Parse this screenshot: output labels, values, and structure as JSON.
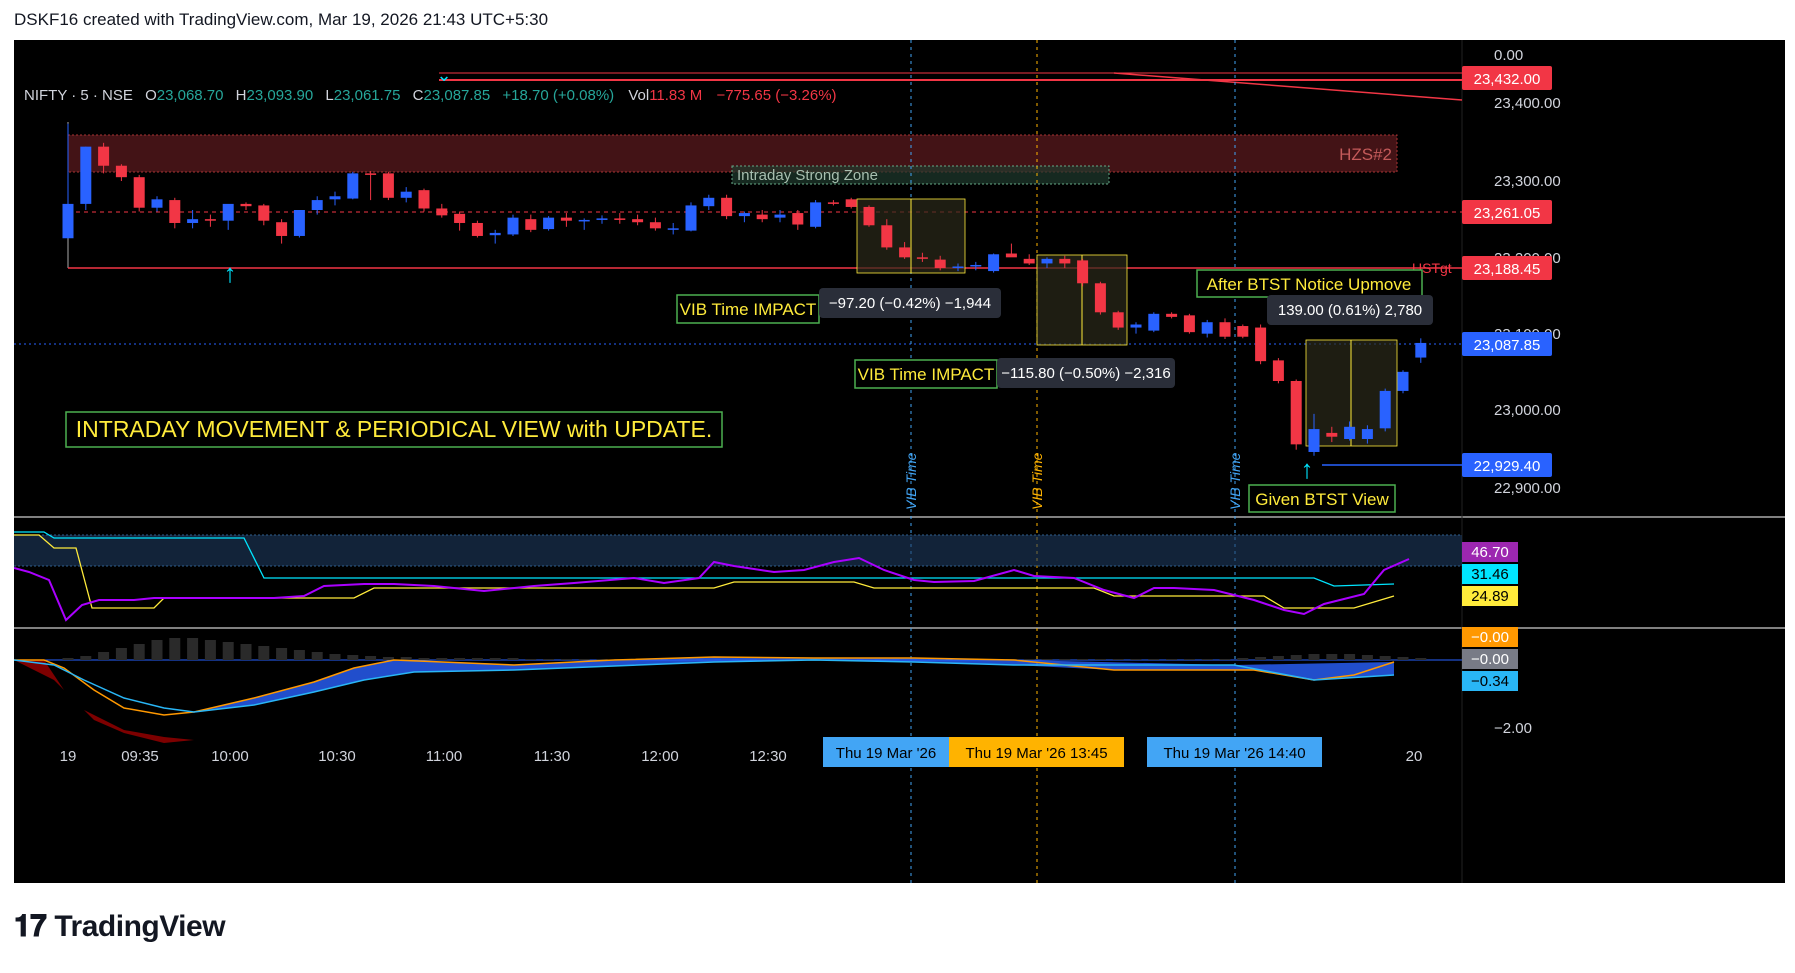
{
  "header": {
    "text": "DSKF16 created with TradingView.com, Mar 19, 2026 21:43 UTC+5:30"
  },
  "footer": {
    "logo_text": "TradingView",
    "logo_icon": "tradingview-logo-icon"
  },
  "legend": {
    "symbol": "NIFTY · 5 · NSE",
    "o_label": "O",
    "o": "23,068.70",
    "h_label": "H",
    "h": "23,093.90",
    "l_label": "L",
    "l": "23,061.75",
    "c_label": "C",
    "c": "23,087.85",
    "change": "+18.70 (+0.08%)",
    "vol_label": "Vol",
    "vol": "11.83 M",
    "vol_change": "−775.65 (−3.26%)"
  },
  "annotations": {
    "zone_label": "HZS#2",
    "strong_zone": "Intraday Strong Zone",
    "ustgt": "USTgt",
    "vib_impact_1": "VIB Time IMPACT",
    "vib_measure_1": "−97.20 (−0.42%) −1,944",
    "vib_impact_2": "VIB Time IMPACT",
    "vib_measure_2": "−115.80 (−0.50%) −2,316",
    "after_btst": "After BTST Notice Upmove",
    "btst_measure": "139.00 (0.61%) 2,780",
    "given_btst": "Given BTST View",
    "main_title": "INTRADAY MOVEMENT & PERIODICAL VIEW with UPDATE.",
    "vib_time": "VIB Time"
  },
  "price_badges": [
    {
      "text": "23,432.00",
      "color": "#f23645"
    },
    {
      "text": "23,261.05",
      "color": "#f23645"
    },
    {
      "text": "23,188.45",
      "color": "#f23645"
    },
    {
      "text": "23,087.85",
      "color": "#2962ff"
    },
    {
      "text": "22,929.40",
      "color": "#2962ff"
    }
  ],
  "price_ticks": [
    "0.00",
    "23,400.00",
    "23,300.00",
    "23,200.00",
    "23,100.00",
    "23,000.00",
    "22,900.00"
  ],
  "rsi_badges": [
    {
      "text": "46.70",
      "color": "#9c27b0"
    },
    {
      "text": "31.46",
      "color": "#00e5ff"
    },
    {
      "text": "24.89",
      "color": "#ffeb3b"
    }
  ],
  "macd_badges": [
    {
      "text": "−0.00",
      "color": "#ff9800"
    },
    {
      "text": "−0.00",
      "color": "#787b86"
    },
    {
      "text": "−0.34",
      "color": "#29b6f6"
    }
  ],
  "macd_ticks": [
    "−2.00"
  ],
  "time_ticks": [
    "19",
    "09:35",
    "10:00",
    "10:30",
    "11:00",
    "11:30",
    "12:00",
    "12:30",
    "20"
  ],
  "time_badges": [
    {
      "text": "Thu 19 Mar '26",
      "color": "#42a5f5"
    },
    {
      "text": "Thu 19 Mar '26   13:45",
      "color": "#ffb300"
    },
    {
      "text": "Thu 19 Mar '26   14:40",
      "color": "#42a5f5"
    }
  ],
  "colors": {
    "up": "#2962ff",
    "down": "#f23645",
    "background": "#000000",
    "accent_green": "#4caf50",
    "accent_yellow": "#ffeb3b"
  },
  "chart_data": {
    "type": "candlestick",
    "symbol": "NIFTY",
    "interval": "5",
    "exchange": "NSE",
    "ylim": [
      22870,
      23450
    ],
    "candles": [
      {
        "o": 23225,
        "h": 23375,
        "l": 23225,
        "c": 23270
      },
      {
        "o": 23270,
        "h": 23345,
        "l": 23262,
        "c": 23345
      },
      {
        "o": 23345,
        "h": 23350,
        "l": 23310,
        "c": 23320
      },
      {
        "o": 23320,
        "h": 23322,
        "l": 23300,
        "c": 23305
      },
      {
        "o": 23305,
        "h": 23308,
        "l": 23260,
        "c": 23265
      },
      {
        "o": 23265,
        "h": 23280,
        "l": 23260,
        "c": 23276
      },
      {
        "o": 23275,
        "h": 23278,
        "l": 23238,
        "c": 23245
      },
      {
        "o": 23245,
        "h": 23262,
        "l": 23238,
        "c": 23250
      },
      {
        "o": 23250,
        "h": 23256,
        "l": 23240,
        "c": 23248
      },
      {
        "o": 23248,
        "h": 23268,
        "l": 23236,
        "c": 23270
      },
      {
        "o": 23270,
        "h": 23272,
        "l": 23262,
        "c": 23267
      },
      {
        "o": 23268,
        "h": 23270,
        "l": 23242,
        "c": 23248
      },
      {
        "o": 23246,
        "h": 23250,
        "l": 23218,
        "c": 23228
      },
      {
        "o": 23228,
        "h": 23262,
        "l": 23226,
        "c": 23262
      },
      {
        "o": 23262,
        "h": 23280,
        "l": 23256,
        "c": 23275
      },
      {
        "o": 23276,
        "h": 23286,
        "l": 23268,
        "c": 23280
      },
      {
        "o": 23277,
        "h": 23312,
        "l": 23276,
        "c": 23310
      },
      {
        "o": 23310,
        "h": 23313,
        "l": 23275,
        "c": 23308
      },
      {
        "o": 23310,
        "h": 23312,
        "l": 23275,
        "c": 23278
      },
      {
        "o": 23278,
        "h": 23292,
        "l": 23272,
        "c": 23286
      },
      {
        "o": 23288,
        "h": 23290,
        "l": 23260,
        "c": 23264
      },
      {
        "o": 23264,
        "h": 23270,
        "l": 23252,
        "c": 23255
      },
      {
        "o": 23257,
        "h": 23260,
        "l": 23235,
        "c": 23245
      },
      {
        "o": 23245,
        "h": 23248,
        "l": 23226,
        "c": 23228
      },
      {
        "o": 23229,
        "h": 23236,
        "l": 23218,
        "c": 23232
      },
      {
        "o": 23230,
        "h": 23256,
        "l": 23228,
        "c": 23252
      },
      {
        "o": 23250,
        "h": 23256,
        "l": 23233,
        "c": 23236
      },
      {
        "o": 23237,
        "h": 23254,
        "l": 23235,
        "c": 23252
      },
      {
        "o": 23252,
        "h": 23258,
        "l": 23240,
        "c": 23248
      },
      {
        "o": 23247,
        "h": 23251,
        "l": 23236,
        "c": 23249
      },
      {
        "o": 23249,
        "h": 23255,
        "l": 23244,
        "c": 23251
      },
      {
        "o": 23251,
        "h": 23258,
        "l": 23244,
        "c": 23249
      },
      {
        "o": 23250,
        "h": 23256,
        "l": 23242,
        "c": 23246
      },
      {
        "o": 23246,
        "h": 23252,
        "l": 23235,
        "c": 23238
      },
      {
        "o": 23237,
        "h": 23245,
        "l": 23230,
        "c": 23238
      },
      {
        "o": 23235,
        "h": 23272,
        "l": 23234,
        "c": 23268
      },
      {
        "o": 23267,
        "h": 23282,
        "l": 23262,
        "c": 23278
      },
      {
        "o": 23278,
        "h": 23282,
        "l": 23250,
        "c": 23254
      },
      {
        "o": 23254,
        "h": 23260,
        "l": 23246,
        "c": 23258
      },
      {
        "o": 23256,
        "h": 23262,
        "l": 23246,
        "c": 23250
      },
      {
        "o": 23252,
        "h": 23262,
        "l": 23246,
        "c": 23256
      },
      {
        "o": 23258,
        "h": 23262,
        "l": 23236,
        "c": 23243
      },
      {
        "o": 23240,
        "h": 23275,
        "l": 23238,
        "c": 23272
      },
      {
        "o": 23272,
        "h": 23275,
        "l": 23268,
        "c": 23270
      },
      {
        "o": 23276,
        "h": 23278,
        "l": 23264,
        "c": 23266
      },
      {
        "o": 23266,
        "h": 23268,
        "l": 23240,
        "c": 23242
      },
      {
        "o": 23242,
        "h": 23250,
        "l": 23210,
        "c": 23213
      },
      {
        "o": 23213,
        "h": 23220,
        "l": 23198,
        "c": 23200
      },
      {
        "o": 23200,
        "h": 23206,
        "l": 23194,
        "c": 23199
      },
      {
        "o": 23197,
        "h": 23202,
        "l": 23183,
        "c": 23186
      },
      {
        "o": 23186,
        "h": 23192,
        "l": 23182,
        "c": 23188
      },
      {
        "o": 23188,
        "h": 23194,
        "l": 23183,
        "c": 23190
      },
      {
        "o": 23182,
        "h": 23205,
        "l": 23180,
        "c": 23204
      },
      {
        "o": 23205,
        "h": 23218,
        "l": 23202,
        "c": 23200
      },
      {
        "o": 23198,
        "h": 23204,
        "l": 23190,
        "c": 23192
      },
      {
        "o": 23192,
        "h": 23200,
        "l": 23186,
        "c": 23198
      },
      {
        "o": 23198,
        "h": 23202,
        "l": 23186,
        "c": 23192
      },
      {
        "o": 23196,
        "h": 23198,
        "l": 23162,
        "c": 23166
      },
      {
        "o": 23166,
        "h": 23168,
        "l": 23125,
        "c": 23128
      },
      {
        "o": 23128,
        "h": 23130,
        "l": 23105,
        "c": 23108
      },
      {
        "o": 23108,
        "h": 23115,
        "l": 23100,
        "c": 23112
      },
      {
        "o": 23104,
        "h": 23128,
        "l": 23102,
        "c": 23126
      },
      {
        "o": 23126,
        "h": 23128,
        "l": 23120,
        "c": 23122
      },
      {
        "o": 23124,
        "h": 23126,
        "l": 23100,
        "c": 23102
      },
      {
        "o": 23100,
        "h": 23118,
        "l": 23095,
        "c": 23115
      },
      {
        "o": 23115,
        "h": 23120,
        "l": 23093,
        "c": 23096
      },
      {
        "o": 23110,
        "h": 23112,
        "l": 23094,
        "c": 23096
      },
      {
        "o": 23108,
        "h": 23112,
        "l": 23060,
        "c": 23064
      },
      {
        "o": 23065,
        "h": 23068,
        "l": 23035,
        "c": 23038
      },
      {
        "o": 23038,
        "h": 23040,
        "l": 22948,
        "c": 22955
      },
      {
        "o": 22945,
        "h": 22995,
        "l": 22940,
        "c": 22975
      },
      {
        "o": 22970,
        "h": 22978,
        "l": 22958,
        "c": 22965
      },
      {
        "o": 22962,
        "h": 22985,
        "l": 22960,
        "c": 22978
      },
      {
        "o": 22962,
        "h": 22980,
        "l": 22956,
        "c": 22975
      },
      {
        "o": 22976,
        "h": 23028,
        "l": 22972,
        "c": 23025
      },
      {
        "o": 23025,
        "h": 23052,
        "l": 23022,
        "c": 23050
      },
      {
        "o": 23068.7,
        "h": 23093.9,
        "l": 23061.75,
        "c": 23087.85
      }
    ],
    "levels": [
      23432.0,
      23261.05,
      23188.45,
      23087.85,
      22929.4
    ]
  }
}
